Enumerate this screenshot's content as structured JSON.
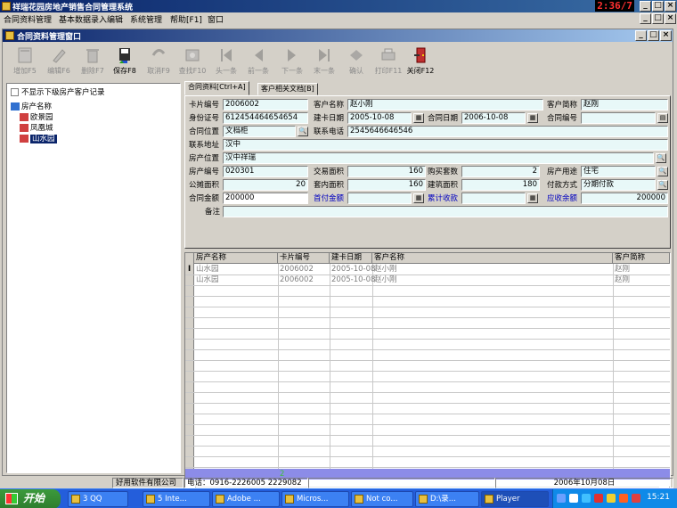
{
  "app": {
    "title": "祥瑞花园房地产销售合同管理系统",
    "clock": "2:36/7",
    "menu": [
      "合同资料管理",
      "基本数据录入编辑",
      "系统管理",
      "帮助[F1]",
      "窗口"
    ]
  },
  "child": {
    "title": "合同资料管理窗口"
  },
  "toolbar": [
    {
      "label": "增加F5",
      "icon": "add-icon",
      "enabled": false
    },
    {
      "label": "编辑F6",
      "icon": "edit-icon",
      "enabled": false
    },
    {
      "label": "删除F7",
      "icon": "delete-icon",
      "enabled": false
    },
    {
      "label": "保存F8",
      "icon": "save-icon",
      "enabled": true
    },
    {
      "label": "取消F9",
      "icon": "cancel-icon",
      "enabled": false
    },
    {
      "label": "查找F10",
      "icon": "find-icon",
      "enabled": false
    },
    {
      "label": "头一条",
      "icon": "first-icon",
      "enabled": false
    },
    {
      "label": "前一条",
      "icon": "prev-icon",
      "enabled": false
    },
    {
      "label": "下一条",
      "icon": "next-icon",
      "enabled": false
    },
    {
      "label": "末一条",
      "icon": "last-icon",
      "enabled": false
    },
    {
      "label": "确认",
      "icon": "confirm-icon",
      "enabled": false
    },
    {
      "label": "打印F11",
      "icon": "print-icon",
      "enabled": false
    },
    {
      "label": "关闭F12",
      "icon": "close-door-icon",
      "enabled": true
    }
  ],
  "left": {
    "checkbox_label": "不显示下级房产客户记录",
    "tree_root": "房产名称",
    "tree_items": [
      "欧景园",
      "凤凰城",
      "山水园"
    ],
    "selected": "山水园"
  },
  "tabs": [
    "合同资料[Ctrl+A]",
    "客户相关文档[B]"
  ],
  "form": {
    "card_no_label": "卡片编号",
    "card_no": "2006002",
    "customer_name_label": "客户名称",
    "customer_name": "赵小刚",
    "customer_short_label": "客户简称",
    "customer_short": "赵刚",
    "id_label": "身份证号",
    "id": "612454464654654",
    "card_date_label": "建卡日期",
    "card_date": "2005-10-08",
    "contract_date_label": "合同日期",
    "contract_date": "2006-10-08",
    "contract_no_label": "合同编号",
    "contract_no": "",
    "contract_loc_label": "合同位置",
    "contract_loc": "文档柜",
    "phone_label": "联系电话",
    "phone": "2545646646546",
    "address_label": "联系地址",
    "address": "汉中",
    "house_loc_label": "房产位置",
    "house_loc": "汉中祥瑞",
    "house_no_label": "房产编号",
    "house_no": "020301",
    "trade_area_label": "交易面积",
    "trade_area": "160",
    "purchase_sets_label": "购买套数",
    "purchase_sets": "2",
    "usage_label": "房产用途",
    "usage": "住宅",
    "shared_area_label": "公摊面积",
    "shared_area": "20",
    "inner_area_label": "套内面积",
    "inner_area": "160",
    "building_area_label": "建筑面积",
    "building_area": "180",
    "pay_method_label": "付款方式",
    "pay_method": "分期付款",
    "amount_label": "合同金额",
    "amount": "200000",
    "down_payment_label": "首付金额",
    "down_payment": "",
    "total_received_label": "累计收款",
    "total_received": "",
    "balance_label": "应收余额",
    "balance": "200000",
    "remark_label": "备注",
    "remark": ""
  },
  "grid": {
    "columns": [
      "房产名称",
      "卡片编号",
      "建卡日期",
      "客户名称",
      "客户简称"
    ],
    "rows": [
      [
        "山水园",
        "2006002",
        "2005-10-08",
        "赵小刚",
        "赵刚"
      ],
      [
        "山水园",
        "2006002",
        "2005-10-08",
        "赵小刚",
        "赵刚"
      ]
    ],
    "row_indicator": "I",
    "summary_card": "2"
  },
  "status": {
    "company": "好用软件有限公司",
    "phone": "电话：0916-2226005   2229082",
    "date": "2006年10月08日"
  },
  "taskbar": {
    "start_label": "开始",
    "tasks": [
      "3 QQ",
      "5 Inte...",
      "Adobe ...",
      "Micros...",
      "Not co...",
      "D:\\录...",
      "Player"
    ],
    "active": "Player",
    "time": "15:21"
  }
}
